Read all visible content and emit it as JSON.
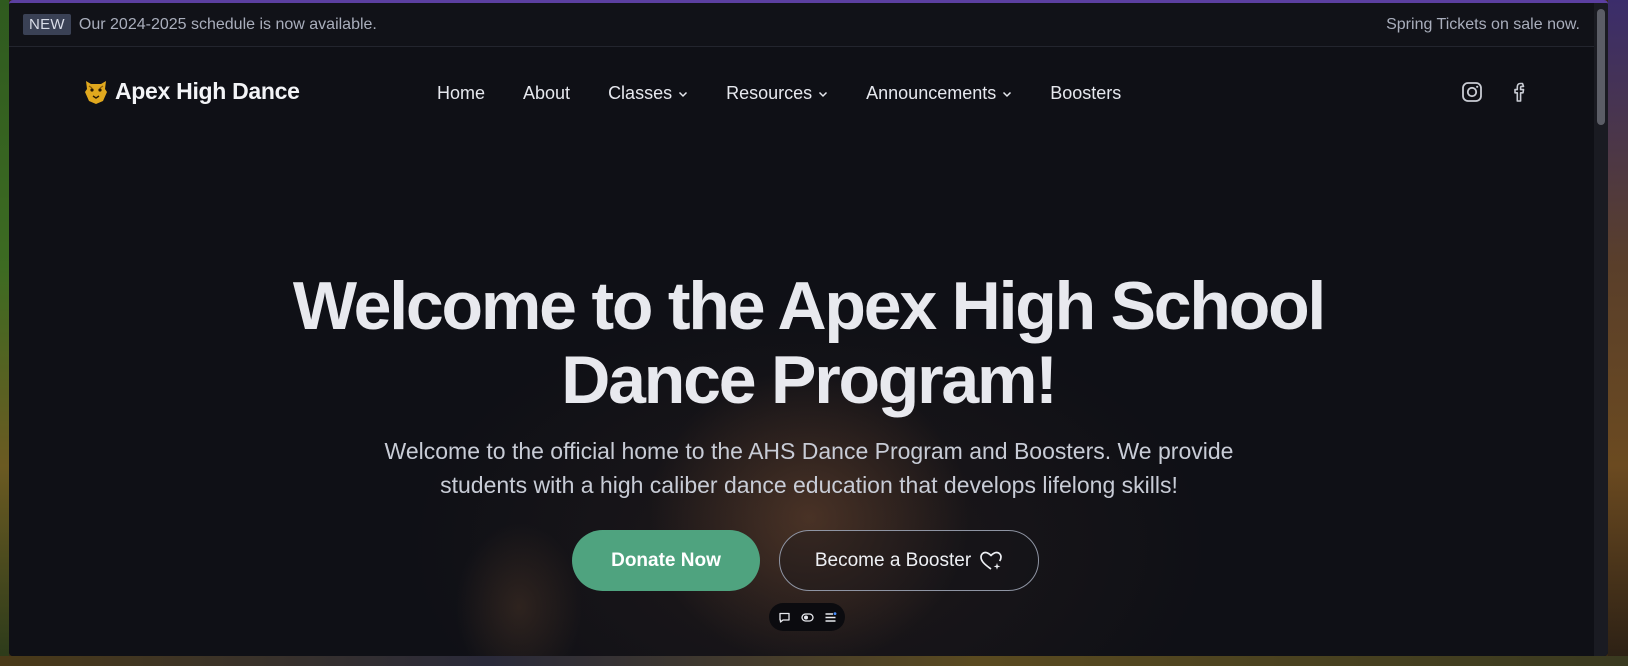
{
  "announcement": {
    "badge": "NEW",
    "message": "Our 2024-2025 schedule is now available.",
    "right_message": "Spring Tickets on sale now."
  },
  "nav": {
    "brand": "Apex High Dance",
    "items": [
      {
        "label": "Home",
        "dropdown": false
      },
      {
        "label": "About",
        "dropdown": false
      },
      {
        "label": "Classes",
        "dropdown": true
      },
      {
        "label": "Resources",
        "dropdown": true
      },
      {
        "label": "Announcements",
        "dropdown": true
      },
      {
        "label": "Boosters",
        "dropdown": false
      }
    ],
    "social": [
      "instagram-icon",
      "facebook-icon"
    ]
  },
  "hero": {
    "title_line1": "Welcome to the Apex High School",
    "title_line2": "Dance Program!",
    "subtitle_line1": "Welcome to the official home to the AHS Dance Program and Boosters. We provide",
    "subtitle_line2": "students with a high caliber dance education that develops lifelong skills!",
    "primary_button": "Donate Now",
    "secondary_button": "Become a Booster"
  },
  "colors": {
    "accent_green": "#4fa37f",
    "background": "#0f1016",
    "window_border": "#5b3fa0",
    "logo_gold": "#e0a81e"
  },
  "mini_toolbar": [
    "comment-icon",
    "toggle-icon",
    "list-icon"
  ]
}
